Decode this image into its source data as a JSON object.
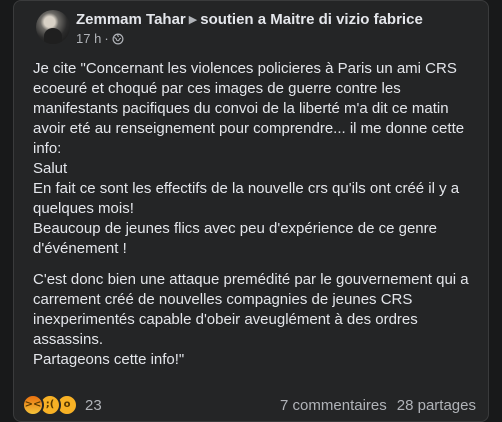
{
  "post": {
    "author": "Zemmam Tahar",
    "group_prefix": "soutien a Maitre di vizio fabrice",
    "time": "17 h",
    "separator": "·",
    "paragraphs": [
      "Je cite \"Concernant les violences policieres à Paris un ami CRS ecoeuré et choqué par ces images de guerre contre les manifestants pacifiques du convoi de la liberté m'a dit ce matin avoir eté au renseignement pour comprendre... il me donne cette info:\nSalut\nEn fait ce sont les effectifs de la nouvelle crs qu'ils ont créé il y a quelques mois!\nBeaucoup de jeunes  flics avec peu d'expérience de ce genre d'événement !",
      "C'est donc bien une attaque premédité par le gouvernement qui a carrement créé de nouvelles compagnies de jeunes CRS inexperimentés capable d'obeir aveuglément à des ordres assassins.\nPartageons  cette info!\""
    ],
    "reactions": {
      "icons": [
        "angry-reaction",
        "sad-reaction",
        "wow-reaction"
      ],
      "count": "23"
    },
    "comments": "7 commentaires",
    "shares": "28 partages"
  }
}
